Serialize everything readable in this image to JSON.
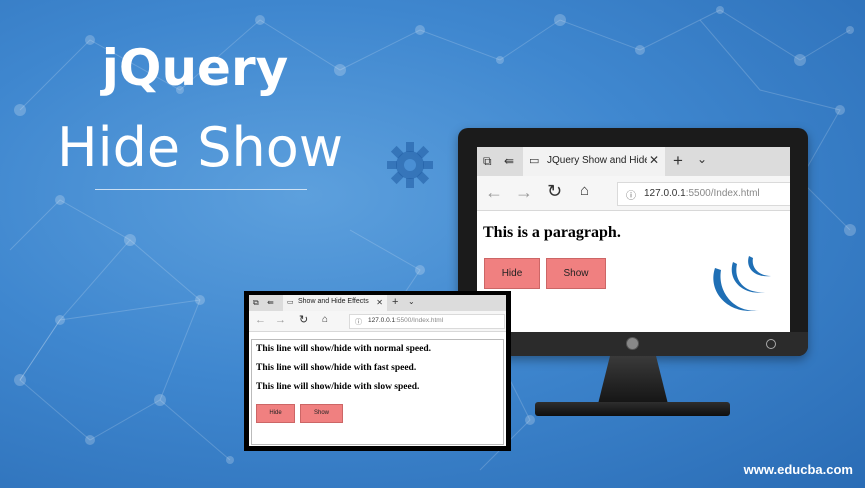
{
  "banner": {
    "title_line1": "jQuery",
    "title_line2": "Hide Show",
    "footer_url": "www.educba.com"
  },
  "monitor_browser": {
    "tab_title": "JQuery Show and Hide I",
    "url_host": "127.0.0.1",
    "url_rest": ":5500/Index.html",
    "page_heading": "This is a paragraph.",
    "hide_button": "Hide",
    "show_button": "Show",
    "button_color": "#f08080"
  },
  "small_browser": {
    "tab_title": "Show and Hide Effects",
    "url_host": "127.0.0.1",
    "url_rest": ":5500/Index.html",
    "lines": [
      "This line will show/hide with normal speed.",
      "This line will show/hide with fast speed.",
      "This line will show/hide with slow speed."
    ],
    "hide_button": "Hide",
    "show_button": "Show"
  },
  "colors": {
    "background": "#3f87cf",
    "accent": "#1f6fb5"
  }
}
